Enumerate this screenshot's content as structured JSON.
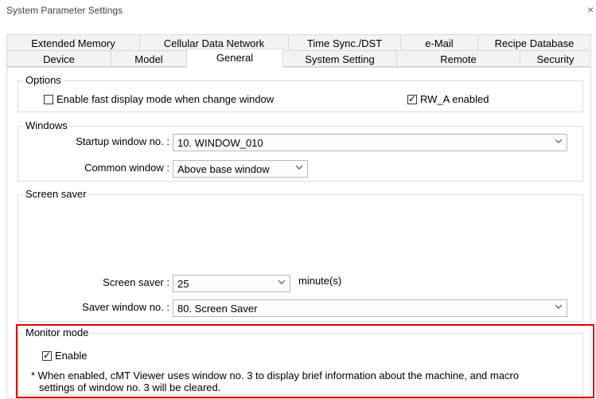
{
  "window": {
    "title": "System Parameter Settings",
    "close_glyph": "×"
  },
  "tabs_row1": [
    "Extended Memory",
    "Cellular Data Network",
    "Time Sync./DST",
    "e-Mail",
    "Recipe Database"
  ],
  "tabs_row2": [
    "Device",
    "Model",
    "General",
    "System Setting",
    "Remote",
    "Security"
  ],
  "active_tab": "General",
  "options": {
    "label": "Options",
    "fast_display": {
      "label": "Enable fast display mode when change window",
      "checked": false
    },
    "rw_a": {
      "label": "RW_A enabled",
      "checked": true
    }
  },
  "windows": {
    "label": "Windows",
    "startup_label": "Startup window no. :",
    "startup_value": "10. WINDOW_010",
    "common_label": "Common window :",
    "common_value": "Above base window"
  },
  "screen_saver": {
    "label": "Screen saver",
    "saver_label": "Screen saver :",
    "saver_value": "25",
    "unit": "minute(s)",
    "window_label": "Saver window no. :",
    "window_value": "80. Screen Saver"
  },
  "monitor_mode": {
    "label": "Monitor mode",
    "enable_label": "Enable",
    "enable_checked": true,
    "note_line1": "* When enabled, cMT Viewer uses window no. 3 to display brief information about the machine, and macro",
    "note_line2": "settings of window no. 3 will be cleared."
  },
  "colors": {
    "highlight": "#e00000",
    "tab_bg": "#f3f3f3",
    "border": "#d9d9d9"
  },
  "icons": {
    "check": "checkmark-icon",
    "dropdown": "chevron-down-icon",
    "close": "close-icon"
  }
}
